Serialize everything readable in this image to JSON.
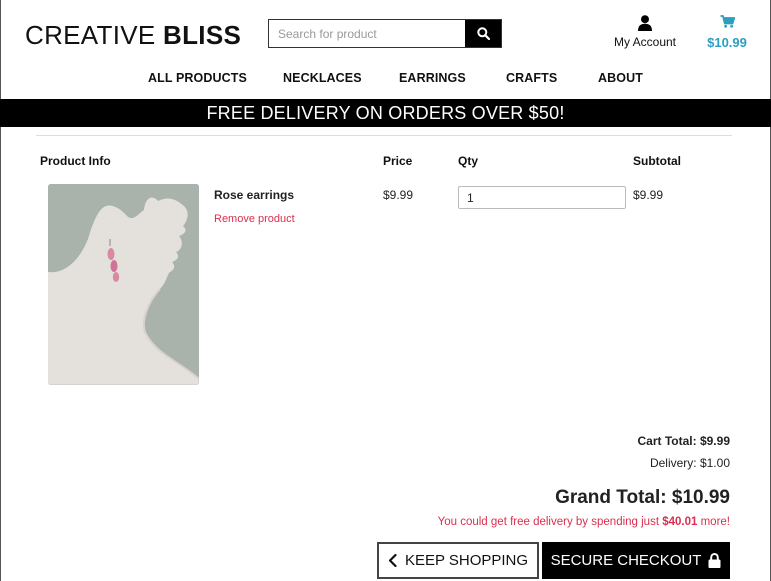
{
  "brand": {
    "logo_part1": "CREATIVE",
    "logo_part2": "BLISS"
  },
  "search": {
    "placeholder": "Search for product",
    "icon": "search-icon"
  },
  "account": {
    "label": "My Account",
    "icon": "user-icon"
  },
  "cart": {
    "total": "$10.99",
    "icon": "cart-icon",
    "accent_color": "#2a9fc1"
  },
  "nav": {
    "items": [
      "ALL PRODUCTS",
      "NECKLACES",
      "EARRINGS",
      "CRAFTS",
      "ABOUT"
    ]
  },
  "banner": {
    "text": "FREE DELIVERY ON ORDERS OVER $50!"
  },
  "table": {
    "headers": {
      "product_info": "Product Info",
      "price": "Price",
      "qty": "Qty",
      "subtotal": "Subtotal"
    },
    "rows": [
      {
        "name": "Rose earrings",
        "remove_label": "Remove product",
        "price": "$9.99",
        "qty": "1",
        "subtotal": "$9.99"
      }
    ]
  },
  "summary": {
    "cart_total": "Cart Total: $9.99",
    "delivery": "Delivery: $1.00",
    "grand_total": "Grand Total: $10.99",
    "free_delivery_prefix": "You could get free delivery by spending just ",
    "free_delivery_amount": "$40.01",
    "free_delivery_suffix": " more!"
  },
  "buttons": {
    "keep_shopping": "KEEP SHOPPING",
    "secure_checkout": "SECURE CHECKOUT"
  },
  "colors": {
    "alert": "#d9304f",
    "banner_bg": "#000000"
  }
}
